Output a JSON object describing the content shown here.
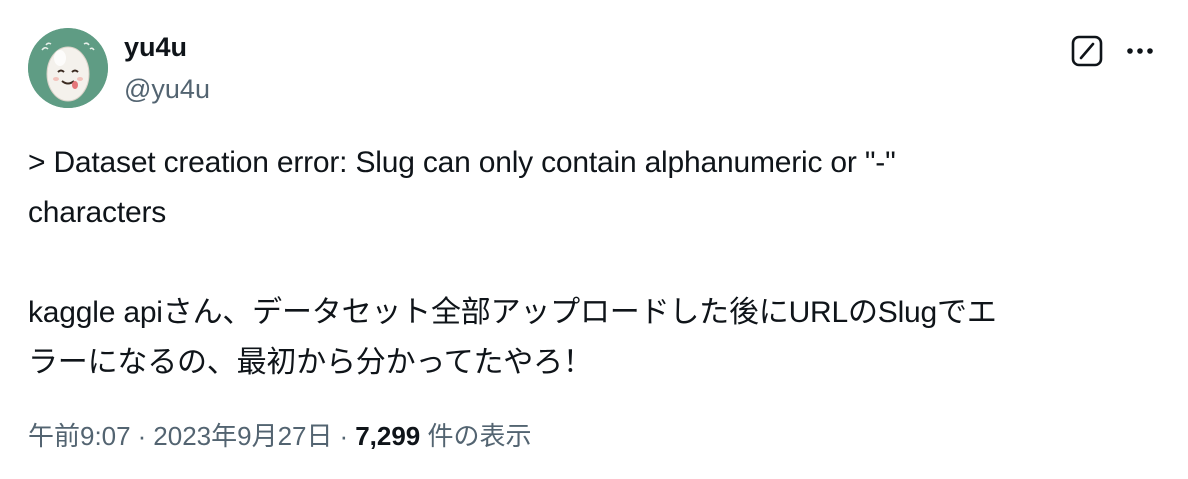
{
  "author": {
    "display_name": "yu4u",
    "handle": "@yu4u",
    "avatar_icon": "egg-character-avatar",
    "avatar_bg": "#5f9c84"
  },
  "actions": {
    "grok_icon": "slash-box-icon",
    "more_icon": "more-horizontal-icon"
  },
  "tweet": {
    "paragraph_1": "> Dataset creation error: Slug can only contain alphanumeric or \"-\"\ncharacters",
    "paragraph_2": "kaggle apiさん、データセット全部アップロードした後にURLのSlugでエ\nラーになるの、最初から分かってたやろ！"
  },
  "meta": {
    "time": "午前9:07",
    "separator": "·",
    "date": "2023年9月27日",
    "views_count": "7,299",
    "views_label": "件の表示"
  },
  "colors": {
    "text_primary": "#0f1419",
    "text_secondary": "#536471"
  }
}
